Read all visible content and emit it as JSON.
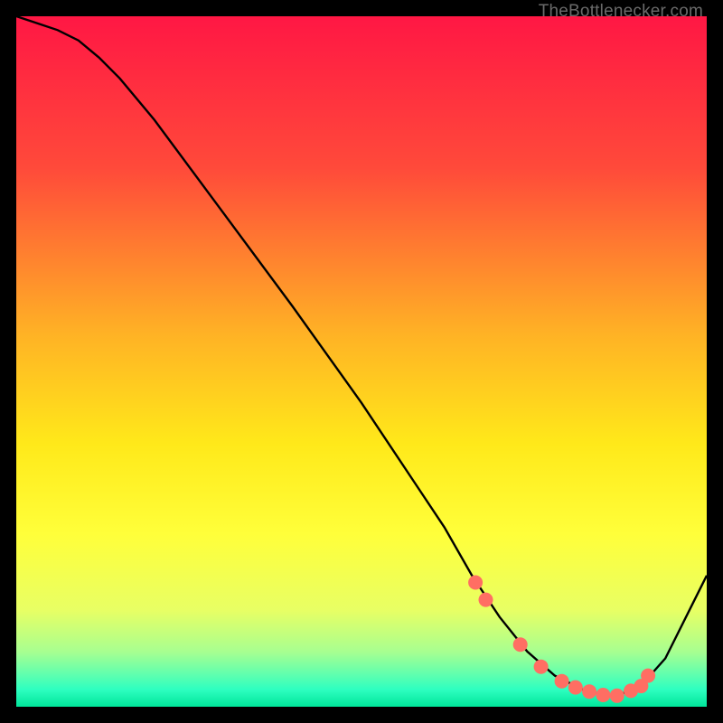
{
  "watermark": "TheBottlenecker.com",
  "chart_data": {
    "type": "line",
    "title": "",
    "xlabel": "",
    "ylabel": "",
    "xlim": [
      0,
      100
    ],
    "ylim": [
      0,
      100
    ],
    "grid": false,
    "legend": false,
    "background_gradient": [
      {
        "pos": 0.0,
        "color": "#ff1744"
      },
      {
        "pos": 0.22,
        "color": "#ff4a3a"
      },
      {
        "pos": 0.46,
        "color": "#ffb225"
      },
      {
        "pos": 0.62,
        "color": "#ffe91a"
      },
      {
        "pos": 0.75,
        "color": "#ffff3a"
      },
      {
        "pos": 0.86,
        "color": "#e8ff64"
      },
      {
        "pos": 0.92,
        "color": "#a8ff90"
      },
      {
        "pos": 0.955,
        "color": "#5cffb0"
      },
      {
        "pos": 0.975,
        "color": "#2effc0"
      },
      {
        "pos": 1.0,
        "color": "#00e59a"
      }
    ],
    "series": [
      {
        "name": "bottleneck-curve",
        "color": "#000000",
        "x": [
          0,
          3,
          6,
          9,
          12,
          15,
          20,
          30,
          40,
          50,
          58,
          62,
          66,
          70,
          74,
          78,
          82,
          86,
          90,
          94,
          100
        ],
        "y": [
          100,
          99,
          98,
          96.5,
          94,
          91,
          85,
          71.5,
          58,
          44,
          32,
          26,
          19,
          13,
          8,
          4.5,
          2.5,
          1.5,
          2.5,
          7,
          19
        ]
      }
    ],
    "markers": {
      "name": "bottleneck-dots",
      "color": "#ff6e63",
      "radius": 8,
      "x": [
        66.5,
        68,
        73,
        76,
        79,
        81,
        83,
        85,
        87,
        89,
        90.5,
        91.5
      ],
      "y": [
        18,
        15.5,
        9,
        5.8,
        3.7,
        2.8,
        2.2,
        1.7,
        1.6,
        2.3,
        3,
        4.5
      ]
    }
  }
}
